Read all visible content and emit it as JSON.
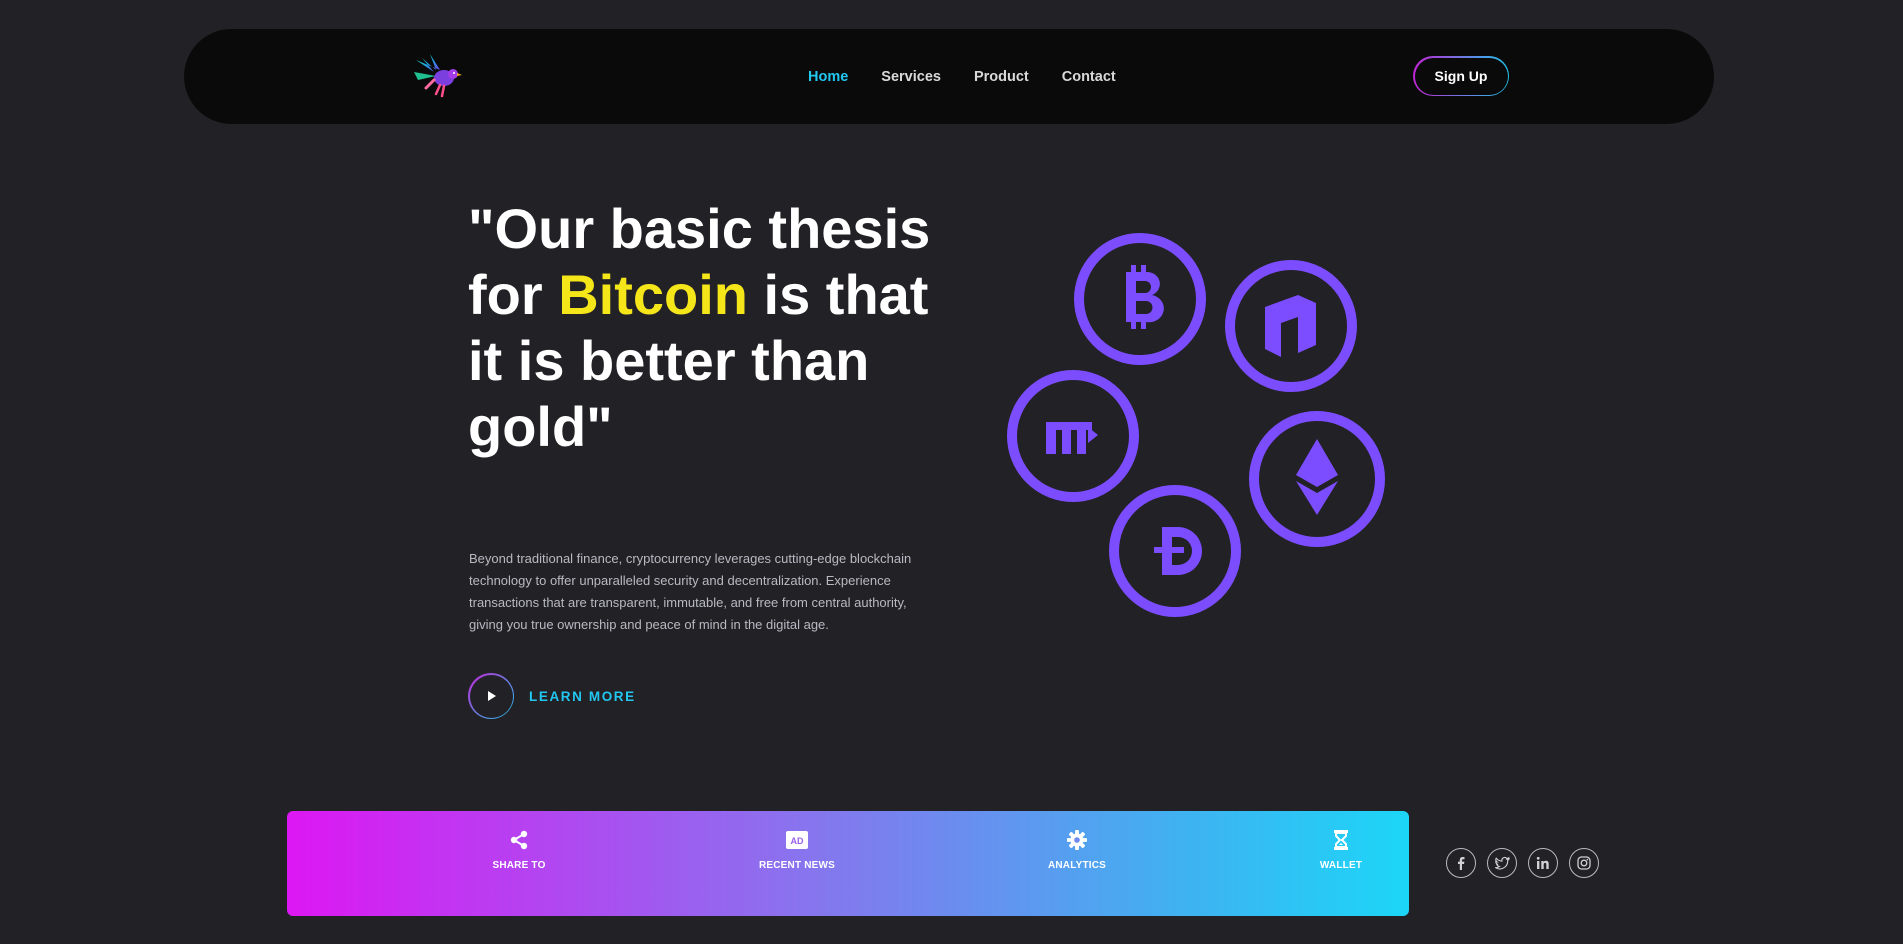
{
  "nav": {
    "logo_icon": "bird-logo",
    "links": [
      {
        "label": "Home",
        "active": true
      },
      {
        "label": "Services",
        "active": false
      },
      {
        "label": "Product",
        "active": false
      },
      {
        "label": "Contact",
        "active": false
      }
    ],
    "signup_label": "Sign Up"
  },
  "hero": {
    "title_before": "\"Our basic thesis for ",
    "title_highlight": "Bitcoin",
    "title_after": " is that it is better than gold\"",
    "description": "Beyond traditional finance, cryptocurrency leverages cutting-edge blockchain technology to offer unparalleled security and decentralization. Experience transactions that are transparent, immutable, and free from central authority, giving you true ownership and peace of mind in the digital age.",
    "cta_label": "LEARN MORE",
    "cta_icon": "play-icon"
  },
  "coins": [
    {
      "icon": "bitcoin-icon"
    },
    {
      "icon": "neo-icon"
    },
    {
      "icon": "monero-icon"
    },
    {
      "icon": "ethereum-icon"
    },
    {
      "icon": "dogecoin-icon"
    }
  ],
  "features": [
    {
      "label": "SHARE TO",
      "icon": "share-icon"
    },
    {
      "label": "RECENT NEWS",
      "icon": "ad-icon"
    },
    {
      "label": "ANALYTICS",
      "icon": "gear-icon"
    },
    {
      "label": "WALLET",
      "icon": "hourglass-icon"
    }
  ],
  "socials": [
    {
      "icon": "facebook-icon"
    },
    {
      "icon": "twitter-icon"
    },
    {
      "icon": "linkedin-icon"
    },
    {
      "icon": "instagram-icon"
    }
  ],
  "colors": {
    "background": "#222126",
    "navbar": "#0a0a0a",
    "accent_cyan": "#22c7f0",
    "highlight_yellow": "#f5e61a",
    "coin_purple": "#7c4dff",
    "gradient_start": "#dd17f3",
    "gradient_end": "#1cd6f7"
  }
}
